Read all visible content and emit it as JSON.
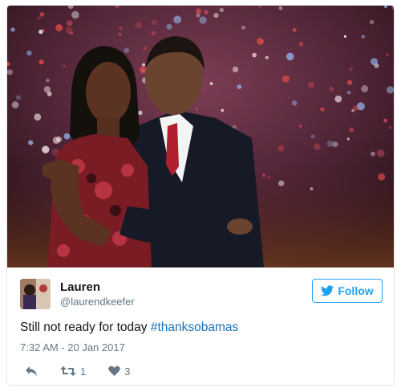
{
  "tweet": {
    "author": {
      "name": "Lauren",
      "handle": "@laurendkeefer"
    },
    "follow_label": "Follow",
    "text": "Still not ready for today ",
    "hashtag": "#thanksobamas",
    "timestamp": "7:32 AM - 20 Jan 2017",
    "retweet_count": "1",
    "like_count": "3"
  },
  "icons": {
    "photo": "photo-of-couple-embracing",
    "avatar": "user-avatar",
    "follow": "twitter-bird-icon",
    "reply": "reply-icon",
    "retweet": "retweet-icon",
    "like": "heart-icon"
  },
  "colors": {
    "accent": "#1da1f2",
    "hashtag": "#1b6fb4",
    "muted": "#657786",
    "text": "#14171a",
    "border": "#e1e8ed"
  }
}
